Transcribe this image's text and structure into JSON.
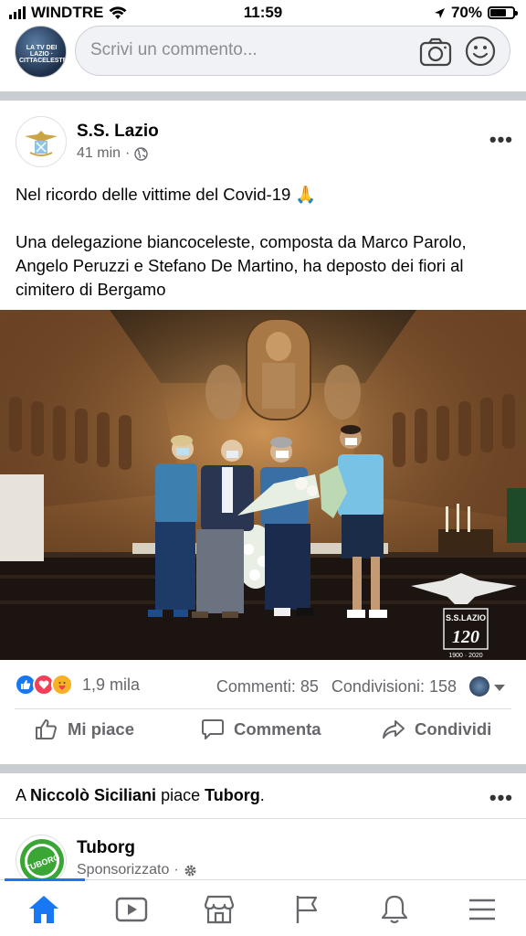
{
  "status_bar": {
    "carrier": "WINDTRE",
    "time": "11:59",
    "battery_percent": "70%",
    "battery_level": 0.7
  },
  "comment_bar": {
    "avatar_text": "LA TV DEI LAZIO · CITTACELESTE",
    "placeholder": "Scrivi un commento...",
    "icons": [
      "camera-icon",
      "smile-icon"
    ]
  },
  "post": {
    "page_name": "S.S. Lazio",
    "time": "41 min",
    "privacy_icon": "globe-icon",
    "text_line1": "Nel ricordo delle vittime del Covid-19 🙏",
    "text_line2": "Una delegazione biancoceleste, composta da Marco Parolo, Angelo Peruzzi e Stefano De Martino, ha deposto dei fiori al cimitero di Bergamo",
    "image_watermark_name": "S.S.LAZIO",
    "image_watermark_years": "1900 · 2020",
    "reactions_icons": [
      "like-icon",
      "love-icon",
      "care-icon"
    ],
    "reactions_count": "1,9 mila",
    "comments": "Commenti: 85",
    "shares": "Condivisioni: 158",
    "actions": {
      "like": "Mi piace",
      "comment": "Commenta",
      "share": "Condividi"
    }
  },
  "notification": {
    "prefix": "A ",
    "friend": "Niccolò Siciliani",
    "middle": " piace ",
    "page": "Tuborg",
    "suffix": "."
  },
  "sponsored": {
    "name": "Tuborg",
    "label": "Sponsorizzato",
    "logo_text": "TUBORG"
  },
  "colors": {
    "accent": "#1877f2",
    "secondary_text": "#65676b",
    "separator": "#c9ccd1"
  },
  "bottom_nav": [
    "home-icon",
    "watch-icon",
    "marketplace-icon",
    "pages-icon",
    "notifications-icon",
    "menu-icon"
  ]
}
